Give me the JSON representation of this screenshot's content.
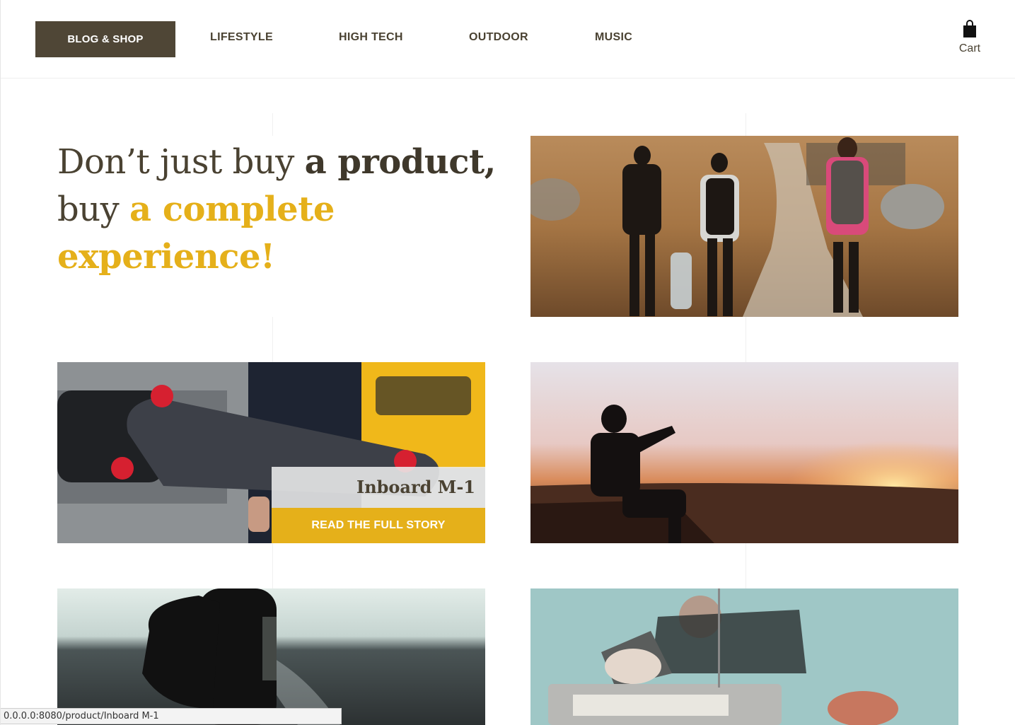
{
  "nav": {
    "brand": "BLOG & SHOP",
    "items": [
      {
        "label": "LIFESTYLE"
      },
      {
        "label": "HIGH TECH"
      },
      {
        "label": "OUTDOOR"
      },
      {
        "label": "MUSIC"
      }
    ],
    "cart_label": "Cart",
    "cart_icon": "shopping-bag-icon"
  },
  "hero": {
    "line1_light": "Don’t just buy ",
    "line1_strong": "a product,",
    "line2_light": "buy ",
    "line2_accent": "a complete experience!"
  },
  "featured": {
    "title": "Inboard M-1",
    "cta": "READ THE FULL STORY"
  },
  "tiles": [
    {
      "name": "hikers-photo",
      "description_icon": "photo"
    },
    {
      "name": "skateboard-photo",
      "description_icon": "photo"
    },
    {
      "name": "sunset-photo",
      "description_icon": "photo"
    },
    {
      "name": "backpack-sea-photo",
      "description_icon": "photo"
    },
    {
      "name": "radio-photo",
      "description_icon": "photo"
    }
  ],
  "status": {
    "url": "0.0.0.0:8080/product/Inboard M-1"
  },
  "colors": {
    "brand_bg": "#4f4636",
    "accent": "#e5b01a",
    "text": "#4a4232"
  }
}
